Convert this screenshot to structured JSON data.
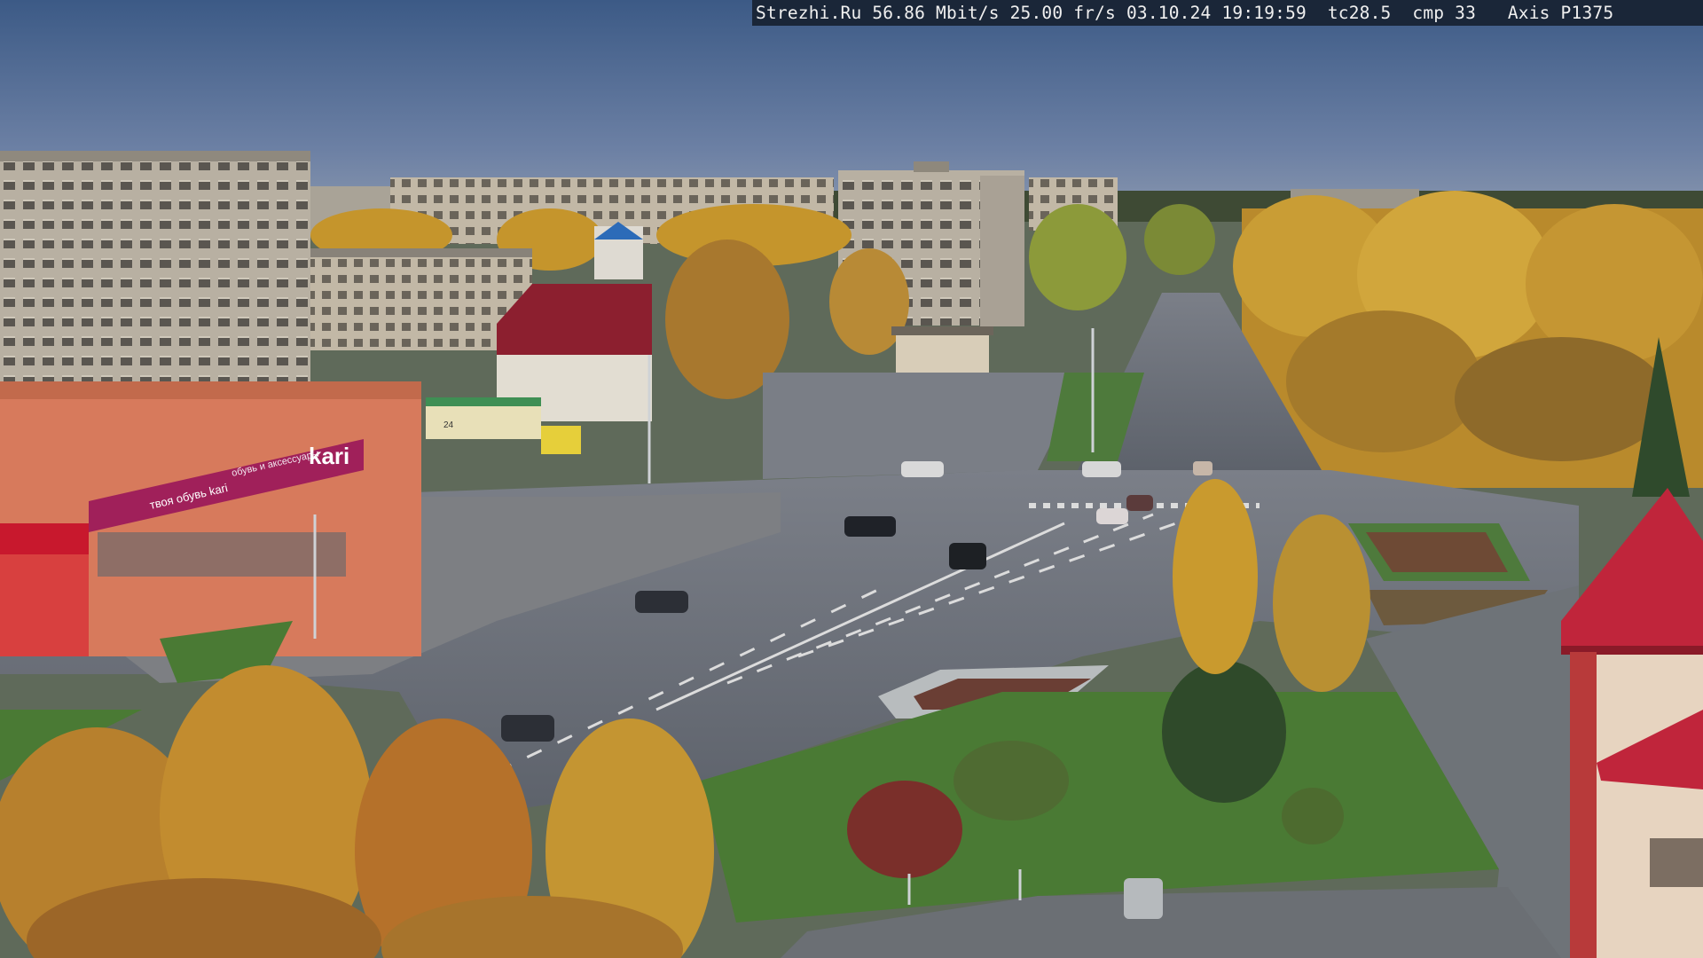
{
  "camera_overlay": {
    "site": "Strezhi.Ru",
    "bitrate": "56.86 Mbit/s",
    "framerate": "25.00 fr/s",
    "date": "03.10.24",
    "time": "19:19:59",
    "tc": "tc28.5",
    "cmp": "cmp 33",
    "camera_model": "Axis P1375"
  },
  "signs": {
    "store_kari": "kari",
    "store_kari_tagline": "твоя обувь kari",
    "store_kari_sub": "обувь и аксессуары",
    "road_sign": "24"
  },
  "colors": {
    "sky_top": "#3f5c86",
    "sky_bottom": "#7689ab",
    "asphalt": "#6a6f78",
    "grass": "#4b7a3a",
    "autumn_yellow": "#c8972e",
    "building_panel": "#b9b2a4",
    "kari_magenta": "#a0205a",
    "roof_red": "#b5283a"
  }
}
